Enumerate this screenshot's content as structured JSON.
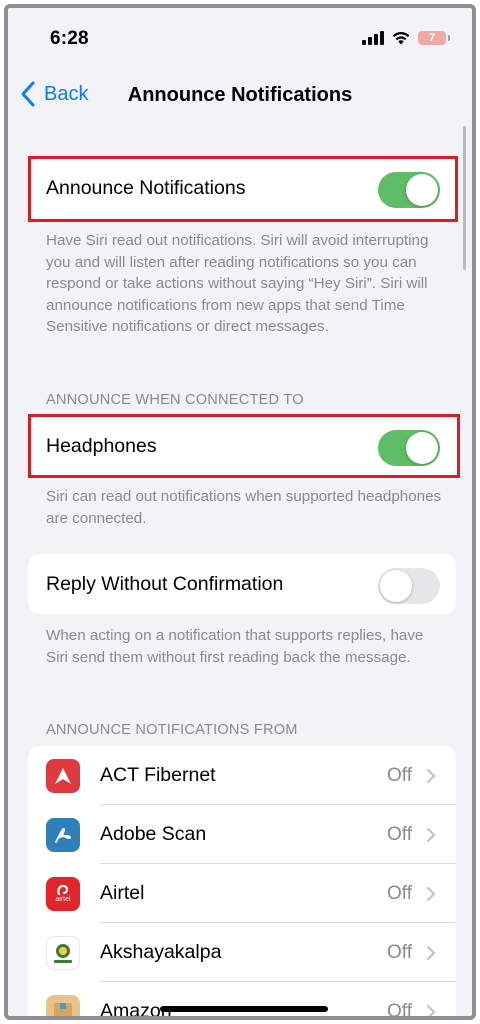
{
  "status_bar": {
    "time": "6:28",
    "battery_level": "7"
  },
  "nav": {
    "back_label": "Back",
    "title": "Announce Notifications"
  },
  "announce_notifications": {
    "label": "Announce Notifications",
    "enabled": true,
    "footer": "Have Siri read out notifications. Siri will avoid interrupting you and will listen after reading notifications so you can respond or take actions without saying “Hey Siri”. Siri will announce notifications from new apps that send Time Sensitive notifications or direct messages."
  },
  "connected_section": {
    "header": "ANNOUNCE WHEN CONNECTED TO",
    "headphones_label": "Headphones",
    "headphones_enabled": true,
    "headphones_footer": "Siri can read out notifications when supported headphones are connected."
  },
  "reply": {
    "label": "Reply Without Confirmation",
    "enabled": false,
    "footer": "When acting on a notification that supports replies, have Siri send them without first reading back the message."
  },
  "apps_section": {
    "header": "ANNOUNCE NOTIFICATIONS FROM",
    "apps": [
      {
        "name": "ACT Fibernet",
        "status": "Off",
        "icon": "act-fibernet-icon",
        "color": "#e0393e"
      },
      {
        "name": "Adobe Scan",
        "status": "Off",
        "icon": "adobe-scan-icon",
        "color": "#2f7fb8"
      },
      {
        "name": "Airtel",
        "status": "Off",
        "icon": "airtel-icon",
        "icon_text": "airtel",
        "color": "#e4242b"
      },
      {
        "name": "Akshayakalpa",
        "status": "Off",
        "icon": "akshayakalpa-icon",
        "color": "#ffffff"
      },
      {
        "name": "Amazon",
        "status": "Off",
        "icon": "amazon-icon",
        "color": "#e8c48a"
      }
    ]
  },
  "colors": {
    "accent": "#0a7aff",
    "toggle_on": "#5ebd66",
    "highlight": "#d81e24"
  }
}
